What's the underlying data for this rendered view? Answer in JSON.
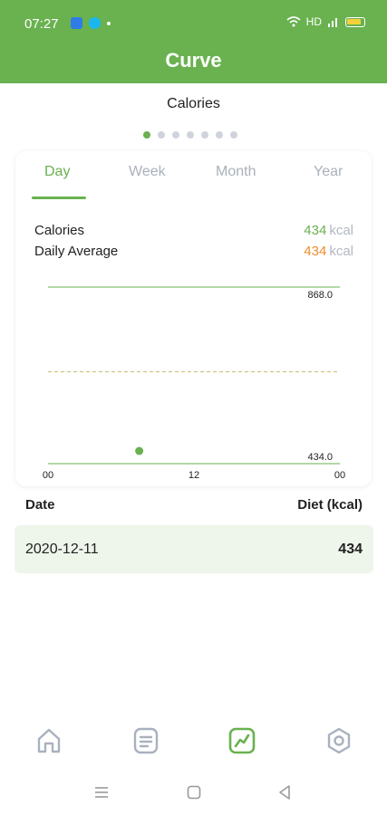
{
  "status_bar": {
    "time": "07:27",
    "network_text": "HD"
  },
  "app_bar": {
    "title": "Curve"
  },
  "section": {
    "title": "Calories",
    "page_dots_count": 7,
    "active_dot": 0
  },
  "tabs": [
    {
      "label": "Day",
      "active": true
    },
    {
      "label": "Week",
      "active": false
    },
    {
      "label": "Month",
      "active": false
    },
    {
      "label": "Year",
      "active": false
    }
  ],
  "stats": {
    "calories_label": "Calories",
    "calories_value": "434",
    "calories_unit": "kcal",
    "average_label": "Daily Average",
    "average_value": "434",
    "average_unit": "kcal"
  },
  "chart_data": {
    "type": "scatter",
    "x_ticks": [
      "00",
      "12",
      "00"
    ],
    "y_ticks": [
      "434.0",
      "868.0"
    ],
    "ylim": [
      434.0,
      868.0
    ],
    "average_line": 651,
    "points": [
      {
        "x": 7.5,
        "y": 434
      }
    ],
    "colors": {
      "point": "#6ab150",
      "grid": "#6ab150",
      "average": "#c9c780"
    }
  },
  "table": {
    "headers": [
      "Date",
      "Diet (kcal)"
    ],
    "rows": [
      {
        "date": "2020-12-11",
        "value": "434"
      }
    ]
  },
  "bottom_nav": [
    {
      "icon": "home-icon",
      "active": false
    },
    {
      "icon": "list-icon",
      "active": false
    },
    {
      "icon": "curve-icon",
      "active": true
    },
    {
      "icon": "gear-icon",
      "active": false
    }
  ],
  "colors": {
    "accent": "#6ab150",
    "orange": "#f08c2b",
    "inactive": "#aab0bb"
  }
}
